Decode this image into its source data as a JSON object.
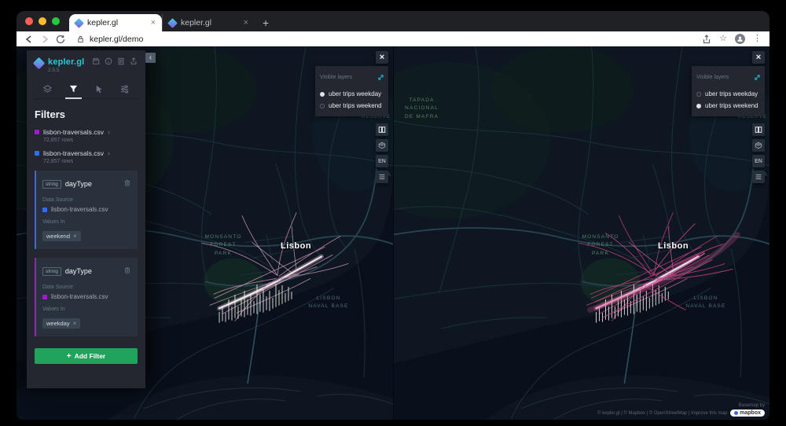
{
  "browser": {
    "tabs": [
      {
        "label": "kepler.gl"
      },
      {
        "label": "kepler.gl"
      }
    ],
    "url": "kepler.gl/demo"
  },
  "glyphs": {
    "close": "×",
    "chevron_left": "‹",
    "plus": "+",
    "kebab": "⋮",
    "star": "☆",
    "dataset_expand": "›"
  },
  "sidebar": {
    "brand": "kepler.gl",
    "version": "2.5.5",
    "panel_title": "Filters",
    "datasets": [
      {
        "name": "lisbon-traversals.csv",
        "rows": "72,857 rows",
        "color": "#a21ccf"
      },
      {
        "name": "lisbon-traversals.csv",
        "rows": "72,857 rows",
        "color": "#2e6df4"
      }
    ],
    "filters": [
      {
        "type_badge": "string",
        "field": "dayType",
        "source_label": "Data Source",
        "dataset": "lisbon-traversals.csv",
        "values_label": "Values In",
        "value": "weekend"
      },
      {
        "type_badge": "string",
        "field": "dayType",
        "source_label": "Data Source",
        "dataset": "lisbon-traversals.csv",
        "values_label": "Values In",
        "value": "weekday"
      }
    ],
    "add_filter": "Add Filter",
    "add_filter_plus": "+"
  },
  "maps": {
    "visible_layers_title": "Visible layers",
    "layers": [
      "uber trips weekday",
      "uber trips weekend"
    ],
    "left_selected": 0,
    "right_selected": 1,
    "locale": "EN"
  },
  "labels": {
    "tapada": "TAPADA\nNACIONAL\nDE MAFRA",
    "reserve": "RESERVE",
    "sa": "SA",
    "monsanto": "MONSANTO\nFOREST\nPARK",
    "city": "Lisbon",
    "naval": "LISBON\nNAVAL BASE"
  },
  "attribution": {
    "line1": "Basemap by",
    "line2": "© kepler.gl | © Mapbox | © OpenStreetMap | Improve this map",
    "mapbox": "mapbox"
  },
  "colors": {
    "accent": "#1fbad6",
    "add_filter_green": "#1fa35d",
    "panel_bg": "#242730",
    "map_bg": "#0e1621"
  }
}
